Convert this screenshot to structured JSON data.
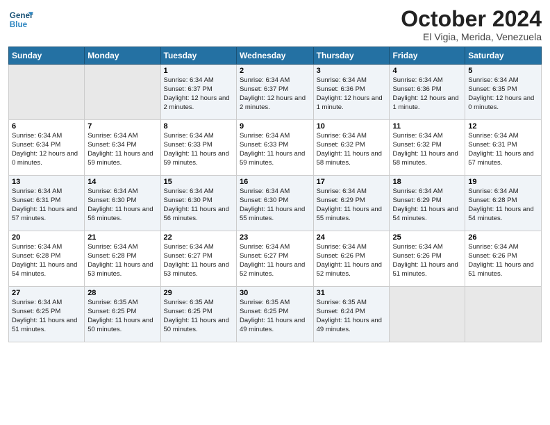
{
  "header": {
    "logo_general": "General",
    "logo_blue": "Blue",
    "month": "October 2024",
    "location": "El Vigia, Merida, Venezuela"
  },
  "days_of_week": [
    "Sunday",
    "Monday",
    "Tuesday",
    "Wednesday",
    "Thursday",
    "Friday",
    "Saturday"
  ],
  "weeks": [
    [
      {
        "day": "",
        "empty": true
      },
      {
        "day": "",
        "empty": true
      },
      {
        "day": "1",
        "sunrise": "Sunrise: 6:34 AM",
        "sunset": "Sunset: 6:37 PM",
        "daylight": "Daylight: 12 hours and 2 minutes."
      },
      {
        "day": "2",
        "sunrise": "Sunrise: 6:34 AM",
        "sunset": "Sunset: 6:37 PM",
        "daylight": "Daylight: 12 hours and 2 minutes."
      },
      {
        "day": "3",
        "sunrise": "Sunrise: 6:34 AM",
        "sunset": "Sunset: 6:36 PM",
        "daylight": "Daylight: 12 hours and 1 minute."
      },
      {
        "day": "4",
        "sunrise": "Sunrise: 6:34 AM",
        "sunset": "Sunset: 6:36 PM",
        "daylight": "Daylight: 12 hours and 1 minute."
      },
      {
        "day": "5",
        "sunrise": "Sunrise: 6:34 AM",
        "sunset": "Sunset: 6:35 PM",
        "daylight": "Daylight: 12 hours and 0 minutes."
      }
    ],
    [
      {
        "day": "6",
        "sunrise": "Sunrise: 6:34 AM",
        "sunset": "Sunset: 6:34 PM",
        "daylight": "Daylight: 12 hours and 0 minutes."
      },
      {
        "day": "7",
        "sunrise": "Sunrise: 6:34 AM",
        "sunset": "Sunset: 6:34 PM",
        "daylight": "Daylight: 11 hours and 59 minutes."
      },
      {
        "day": "8",
        "sunrise": "Sunrise: 6:34 AM",
        "sunset": "Sunset: 6:33 PM",
        "daylight": "Daylight: 11 hours and 59 minutes."
      },
      {
        "day": "9",
        "sunrise": "Sunrise: 6:34 AM",
        "sunset": "Sunset: 6:33 PM",
        "daylight": "Daylight: 11 hours and 59 minutes."
      },
      {
        "day": "10",
        "sunrise": "Sunrise: 6:34 AM",
        "sunset": "Sunset: 6:32 PM",
        "daylight": "Daylight: 11 hours and 58 minutes."
      },
      {
        "day": "11",
        "sunrise": "Sunrise: 6:34 AM",
        "sunset": "Sunset: 6:32 PM",
        "daylight": "Daylight: 11 hours and 58 minutes."
      },
      {
        "day": "12",
        "sunrise": "Sunrise: 6:34 AM",
        "sunset": "Sunset: 6:31 PM",
        "daylight": "Daylight: 11 hours and 57 minutes."
      }
    ],
    [
      {
        "day": "13",
        "sunrise": "Sunrise: 6:34 AM",
        "sunset": "Sunset: 6:31 PM",
        "daylight": "Daylight: 11 hours and 57 minutes."
      },
      {
        "day": "14",
        "sunrise": "Sunrise: 6:34 AM",
        "sunset": "Sunset: 6:30 PM",
        "daylight": "Daylight: 11 hours and 56 minutes."
      },
      {
        "day": "15",
        "sunrise": "Sunrise: 6:34 AM",
        "sunset": "Sunset: 6:30 PM",
        "daylight": "Daylight: 11 hours and 56 minutes."
      },
      {
        "day": "16",
        "sunrise": "Sunrise: 6:34 AM",
        "sunset": "Sunset: 6:30 PM",
        "daylight": "Daylight: 11 hours and 55 minutes."
      },
      {
        "day": "17",
        "sunrise": "Sunrise: 6:34 AM",
        "sunset": "Sunset: 6:29 PM",
        "daylight": "Daylight: 11 hours and 55 minutes."
      },
      {
        "day": "18",
        "sunrise": "Sunrise: 6:34 AM",
        "sunset": "Sunset: 6:29 PM",
        "daylight": "Daylight: 11 hours and 54 minutes."
      },
      {
        "day": "19",
        "sunrise": "Sunrise: 6:34 AM",
        "sunset": "Sunset: 6:28 PM",
        "daylight": "Daylight: 11 hours and 54 minutes."
      }
    ],
    [
      {
        "day": "20",
        "sunrise": "Sunrise: 6:34 AM",
        "sunset": "Sunset: 6:28 PM",
        "daylight": "Daylight: 11 hours and 54 minutes."
      },
      {
        "day": "21",
        "sunrise": "Sunrise: 6:34 AM",
        "sunset": "Sunset: 6:28 PM",
        "daylight": "Daylight: 11 hours and 53 minutes."
      },
      {
        "day": "22",
        "sunrise": "Sunrise: 6:34 AM",
        "sunset": "Sunset: 6:27 PM",
        "daylight": "Daylight: 11 hours and 53 minutes."
      },
      {
        "day": "23",
        "sunrise": "Sunrise: 6:34 AM",
        "sunset": "Sunset: 6:27 PM",
        "daylight": "Daylight: 11 hours and 52 minutes."
      },
      {
        "day": "24",
        "sunrise": "Sunrise: 6:34 AM",
        "sunset": "Sunset: 6:26 PM",
        "daylight": "Daylight: 11 hours and 52 minutes."
      },
      {
        "day": "25",
        "sunrise": "Sunrise: 6:34 AM",
        "sunset": "Sunset: 6:26 PM",
        "daylight": "Daylight: 11 hours and 51 minutes."
      },
      {
        "day": "26",
        "sunrise": "Sunrise: 6:34 AM",
        "sunset": "Sunset: 6:26 PM",
        "daylight": "Daylight: 11 hours and 51 minutes."
      }
    ],
    [
      {
        "day": "27",
        "sunrise": "Sunrise: 6:34 AM",
        "sunset": "Sunset: 6:25 PM",
        "daylight": "Daylight: 11 hours and 51 minutes."
      },
      {
        "day": "28",
        "sunrise": "Sunrise: 6:35 AM",
        "sunset": "Sunset: 6:25 PM",
        "daylight": "Daylight: 11 hours and 50 minutes."
      },
      {
        "day": "29",
        "sunrise": "Sunrise: 6:35 AM",
        "sunset": "Sunset: 6:25 PM",
        "daylight": "Daylight: 11 hours and 50 minutes."
      },
      {
        "day": "30",
        "sunrise": "Sunrise: 6:35 AM",
        "sunset": "Sunset: 6:25 PM",
        "daylight": "Daylight: 11 hours and 49 minutes."
      },
      {
        "day": "31",
        "sunrise": "Sunrise: 6:35 AM",
        "sunset": "Sunset: 6:24 PM",
        "daylight": "Daylight: 11 hours and 49 minutes."
      },
      {
        "day": "",
        "empty": true
      },
      {
        "day": "",
        "empty": true
      }
    ]
  ]
}
